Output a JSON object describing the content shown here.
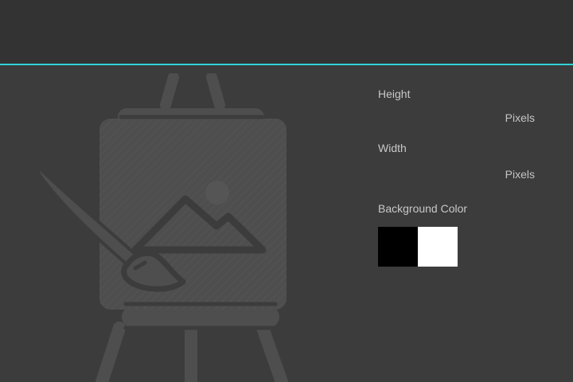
{
  "colors": {
    "accent": "#2fd3d8",
    "topbar": "#333333",
    "background": "#3c3c3c",
    "illustration": "#4e4e4e"
  },
  "placeholder_icon": "easel-painting-icon",
  "settings": {
    "height_label": "Height",
    "height_value": "",
    "height_unit": "Pixels",
    "width_label": "Width",
    "width_value": "",
    "width_unit": "Pixels",
    "background_color_label": "Background Color",
    "swatches": [
      {
        "name": "black",
        "color": "#000000"
      },
      {
        "name": "white",
        "color": "#ffffff"
      }
    ]
  }
}
